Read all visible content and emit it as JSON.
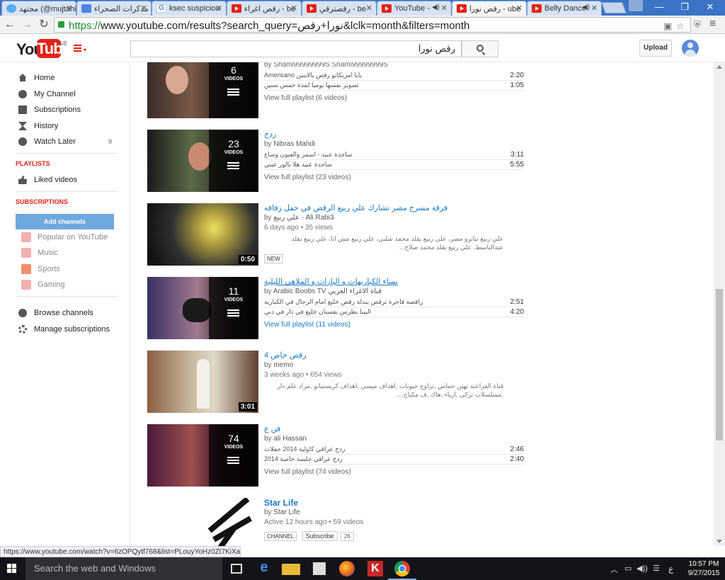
{
  "browser": {
    "tabs": [
      {
        "title": "مجتهد (@mujtahidd",
        "icon": "twitter-icon",
        "active": false
      },
      {
        "title": "مذكرات الصحراء",
        "icon": "document-icon",
        "active": false
      },
      {
        "title": "ksec suspiciou",
        "icon": "google-icon",
        "active": false
      },
      {
        "title": "رقص اغراء - be",
        "icon": "youtube-icon",
        "active": false
      },
      {
        "title": "رقصترقي - be",
        "icon": "youtube-icon",
        "active": false
      },
      {
        "title": "YouTube -",
        "icon": "youtube-icon",
        "active": false
      },
      {
        "title": "رقص نورا - ube",
        "icon": "youtube-icon",
        "active": true
      },
      {
        "title": "Belly Dance",
        "icon": "youtube-icon",
        "active": false
      }
    ],
    "url_scheme": "https://",
    "url_rest": "www.youtube.com/results?search_query=نورا+رقص&lclk=month&filters=month",
    "status_url": "https://www.youtube.com/watch?v=6zOPQytf768&list=PLouyYoHz0Zt7KiXaZ..."
  },
  "youtube": {
    "logo_you": "You",
    "logo_tube": "Tube",
    "region": "GB",
    "search_value": "رقص نورا",
    "upload_label": "Upload"
  },
  "guide": {
    "items": [
      {
        "label": "Home",
        "icon": "home-icon"
      },
      {
        "label": "My Channel",
        "icon": "my-channel-icon"
      },
      {
        "label": "Subscriptions",
        "icon": "subscriptions-icon"
      },
      {
        "label": "History",
        "icon": "history-icon"
      },
      {
        "label": "Watch Later",
        "icon": "watch-later-icon",
        "count": "9"
      }
    ],
    "playlists_heading": "PLAYLISTS",
    "liked_videos": "Liked videos",
    "subscriptions_heading": "SUBSCRIPTIONS",
    "add_channels": "Add channels",
    "subscriptions": [
      {
        "label": "Popular on YouTube",
        "icon": "popular-icon"
      },
      {
        "label": "Music",
        "icon": "music-icon"
      },
      {
        "label": "Sports",
        "icon": "sports-icon"
      },
      {
        "label": "Gaming",
        "icon": "gaming-icon"
      }
    ],
    "browse_channels": "Browse channels",
    "manage_subscriptions": "Manage subscriptions"
  },
  "results": {
    "p1": {
      "count": "6",
      "videos_label": "VIDEOS",
      "byline": "by Shami99999999S Shami99999999S",
      "rows": [
        {
          "title": "Americano بابا امريكانو رقص بالابنين",
          "duration": "2:20"
        },
        {
          "title": "تصوير نفسها يوميا لمدة خمس سنين",
          "duration": "1:05"
        }
      ],
      "view_full": "View full playlist (6 videos)"
    },
    "p2": {
      "title": "ردح",
      "count": "23",
      "videos_label": "VIDEOS",
      "by": "by",
      "channel": "Nibras Mahdi",
      "rows": [
        {
          "title": "ساجدة عبيد - اسمر والعيون وساع",
          "duration": "3:11"
        },
        {
          "title": "ساجدة عبيد هلا بالور عيني",
          "duration": "5:55"
        }
      ],
      "view_full": "View full playlist (23 videos)"
    },
    "v3": {
      "title": "فرقة مسرح مصر تشارك علي ربيع الرقص في حفل زفافه",
      "by": "by",
      "channel": "علي ربيع - Ali Rabi3",
      "meta": "6 days ago • 35 views",
      "description": "علي ربيع تياترو مصر، علي ربيع يقلد محمد شلبي، علي ربيع مش انا، علي ربيع يقلد عبدالباسط، علي ربيع يقلد محمد صلاح...",
      "duration": "0:50",
      "badge": "NEW"
    },
    "p4": {
      "title": "نساء الكباريهات و البارات و الملاهي الليلية",
      "count": "11",
      "videos_label": "VIDEOS",
      "by": "by",
      "channel": "Arabic Boobs TV قناة الاغراء العربي",
      "rows": [
        {
          "title": "راقصة فاجرة ترقص ببدلة رقص خليع امام الرجال في الكباريه",
          "duration": "2:51"
        },
        {
          "title": "البينا بطرس بفستان خليع في دار في دبي",
          "duration": "4:20"
        }
      ],
      "view_full": "View full playlist (11 videos)"
    },
    "v5": {
      "title": "رقص خاص 4",
      "by": "by",
      "channel": "memo",
      "meta": "3 weeks ago • 654 views",
      "description": "قناة الفراعنة نهين حماس ,تزاوج حيونات ,اهداف ميسي ,اهداف كريستيانو ,مراد علم دار ,مسلسلات تركي ,ازياء ,هاك ,ف مكياج,...",
      "duration": "3:01"
    },
    "p6": {
      "title": "فن ع",
      "count": "74",
      "videos_label": "VIDEOS",
      "by": "by",
      "channel": "ali Hassan",
      "rows": [
        {
          "title": "ردح عراقي كاولية 2014 حفلات",
          "duration": "2:46"
        },
        {
          "title": "ردح عراقي جلسة خاصة 2014",
          "duration": "2:40"
        }
      ],
      "view_full": "View full playlist (74 videos)"
    },
    "c7": {
      "title": "Star Life",
      "by": "by",
      "channel": "Star Life",
      "meta": "Active 12 hours ago • 59 videos",
      "badge": "CHANNEL",
      "subscribe": "Subscribe",
      "sub_count": "26"
    }
  },
  "taskbar": {
    "search_placeholder": "Search the web and Windows",
    "lang": "ع",
    "time": "10:57 PM",
    "date": "9/27/2015"
  }
}
